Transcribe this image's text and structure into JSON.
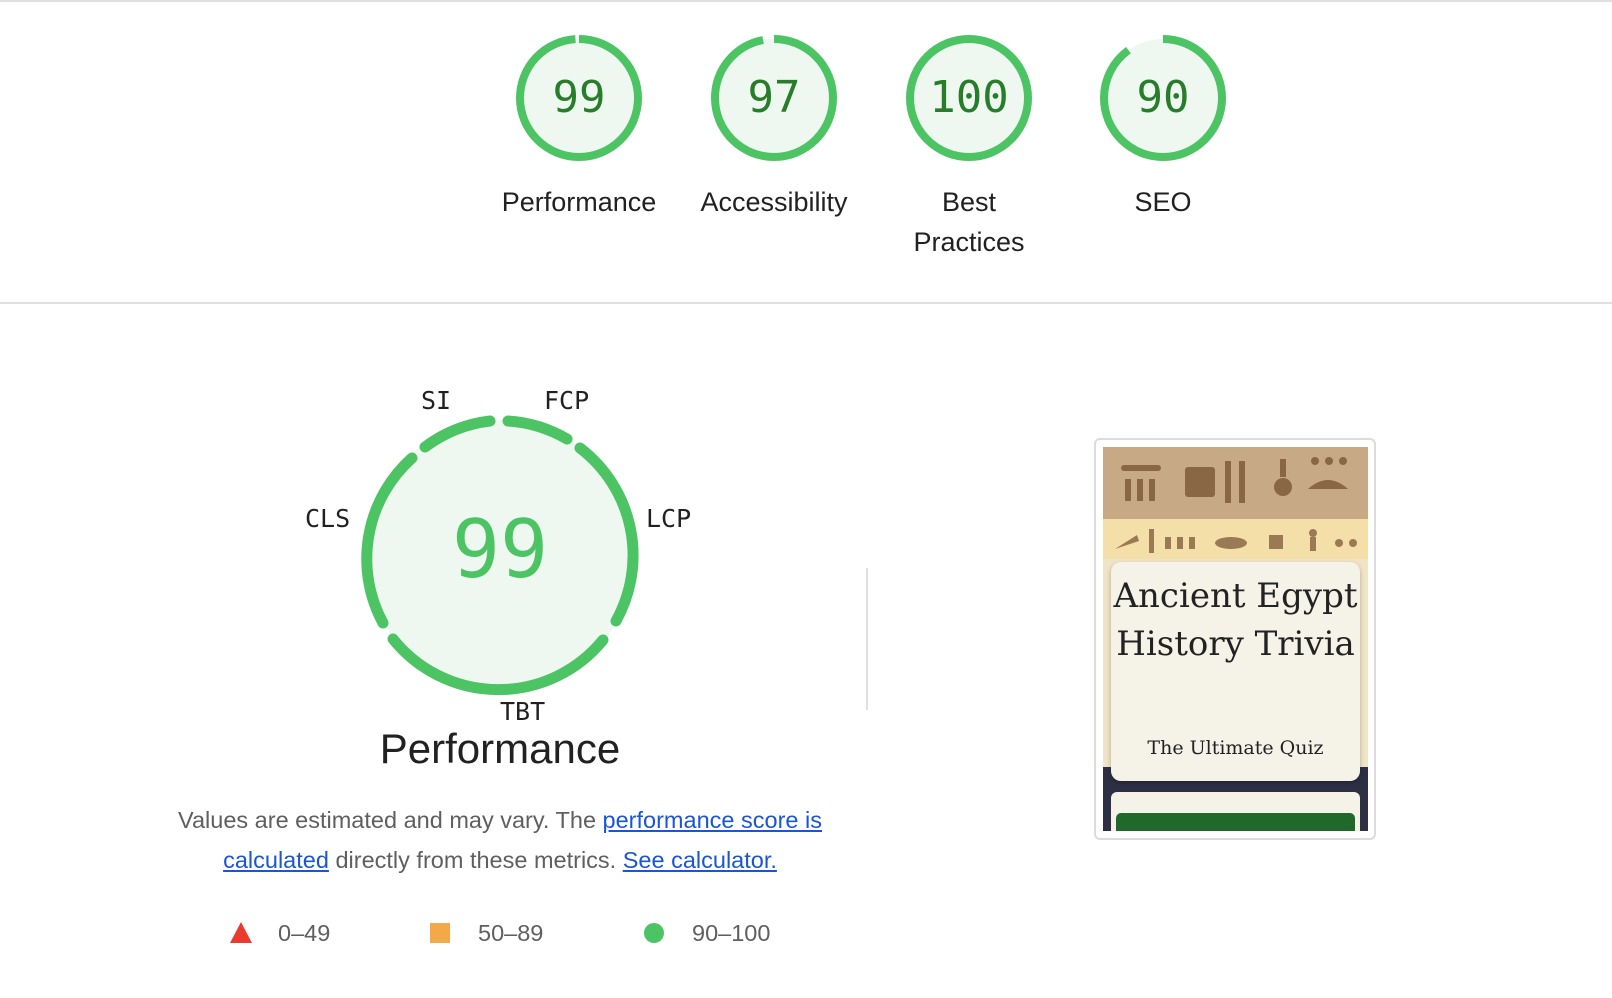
{
  "summary": {
    "categories": [
      {
        "label": "Performance",
        "score": "99",
        "fraction": 0.99
      },
      {
        "label": "Accessibility",
        "score": "97",
        "fraction": 0.97
      },
      {
        "label": "Best Practices",
        "score": "100",
        "fraction": 1.0
      },
      {
        "label": "SEO",
        "score": "90",
        "fraction": 0.9
      }
    ]
  },
  "performance": {
    "score": "99",
    "title": "Performance",
    "metrics": {
      "si": "SI",
      "fcp": "FCP",
      "cls": "CLS",
      "lcp": "LCP",
      "tbt": "TBT"
    },
    "description": {
      "text_before": "Values are estimated and may vary. The ",
      "link_score": "performance score is calculated",
      "text_middle": " directly from these metrics. ",
      "link_calculator": "See calculator."
    },
    "legend": [
      {
        "shape": "triangle",
        "range": "0–49",
        "color": "#eb3b2e"
      },
      {
        "shape": "square",
        "range": "50–89",
        "color": "#f3a949"
      },
      {
        "shape": "circle",
        "range": "90–100",
        "color": "#4cc463"
      }
    ]
  },
  "screenshot": {
    "title": "Ancient Egypt History Trivia",
    "subtitle": "The Ultimate Quiz"
  },
  "colors": {
    "pass": "#4cc463",
    "pass_text": "#287d2b",
    "pass_fill": "#eef8f0",
    "link": "#1a55d8"
  }
}
